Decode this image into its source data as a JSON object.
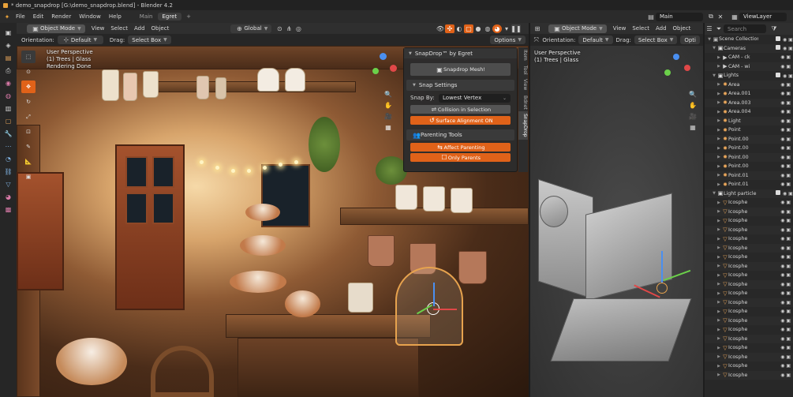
{
  "window": {
    "title": "* demo_snapdrop [G:\\demo_snapdrop.blend] - Blender 4.2"
  },
  "menu": {
    "items": [
      "File",
      "Edit",
      "Render",
      "Window",
      "Help"
    ]
  },
  "workspaces": {
    "tabs": [
      {
        "label": "Main",
        "active": false
      },
      {
        "label": "Egret",
        "active": true
      }
    ],
    "add_label": "+"
  },
  "topright": {
    "scene_label": "Main",
    "viewlayer_label": "ViewLayer"
  },
  "editor_left": {
    "mode": "Object Mode",
    "menus": [
      "View",
      "Select",
      "Add",
      "Object"
    ],
    "transform": "Global",
    "orientation_label": "Orientation:",
    "orientation_value": "Default",
    "drag_label": "Drag:",
    "drag_value": "Select Box",
    "options_label": "Options",
    "overlay": {
      "line1": "User Perspective",
      "line2": "(1) Trees | Glass",
      "line3": "Rendering Done"
    }
  },
  "npanel": {
    "title": "SnapDrop™ by Egret",
    "snapdrop_button": "Snapdrop Mesh!",
    "snap_settings": "Snap Settings",
    "snap_by_label": "Snap By:",
    "snap_by_value": "Lowest Vertex",
    "collision_button": "Collision in Selection",
    "surface_button": "Surface Alignment ON",
    "parenting_tools": "Parenting Tools",
    "affect_button": "Affect Parenting",
    "only_parents_button": "Only Parents",
    "accent": "#e06219"
  },
  "sidetabs": {
    "items": [
      "Item",
      "Tool",
      "View",
      "Bdnet",
      "SnapDrop"
    ]
  },
  "editor_right": {
    "mode": "Object Mode",
    "menus": [
      "View",
      "Select",
      "Add",
      "Object"
    ],
    "orientation_label": "Orientation:",
    "orientation_value": "Default",
    "drag_label": "Drag:",
    "drag_value": "Select Box",
    "options_label": "Opti",
    "overlay": {
      "line1": "User Perspective",
      "line2": "(1) Trees | Glass"
    }
  },
  "outliner": {
    "search_placeholder": "Search",
    "rows": [
      {
        "name": "Scene Collection",
        "depth": 0,
        "icon": "box",
        "color": "#bdbdbd",
        "collection": true
      },
      {
        "name": "Cameras",
        "depth": 1,
        "icon": "box",
        "color": "#e0e0e0",
        "collection": true
      },
      {
        "name": "CAM - ck",
        "depth": 2,
        "icon": "cam",
        "color": "#cfcfcf"
      },
      {
        "name": "CAM - wi",
        "depth": 2,
        "icon": "cam",
        "color": "#cfcfcf"
      },
      {
        "name": "Lights",
        "depth": 1,
        "icon": "box",
        "color": "#e0e0e0",
        "collection": true
      },
      {
        "name": "Area",
        "depth": 2,
        "icon": "light",
        "color": "#e8a55a"
      },
      {
        "name": "Area.001",
        "depth": 2,
        "icon": "light",
        "color": "#e8a55a"
      },
      {
        "name": "Area.003",
        "depth": 2,
        "icon": "light",
        "color": "#e8a55a"
      },
      {
        "name": "Area.004",
        "depth": 2,
        "icon": "light",
        "color": "#e8a55a"
      },
      {
        "name": "Light",
        "depth": 2,
        "icon": "light",
        "color": "#e8a55a"
      },
      {
        "name": "Point",
        "depth": 2,
        "icon": "light",
        "color": "#e8a55a"
      },
      {
        "name": "Point.00",
        "depth": 2,
        "icon": "light",
        "color": "#e8a55a"
      },
      {
        "name": "Point.00",
        "depth": 2,
        "icon": "light",
        "color": "#e8a55a"
      },
      {
        "name": "Point.00",
        "depth": 2,
        "icon": "light",
        "color": "#e8a55a"
      },
      {
        "name": "Point.00",
        "depth": 2,
        "icon": "light",
        "color": "#e8a55a"
      },
      {
        "name": "Point.01",
        "depth": 2,
        "icon": "light",
        "color": "#e8a55a"
      },
      {
        "name": "Point.01",
        "depth": 2,
        "icon": "light",
        "color": "#e8a55a"
      },
      {
        "name": "Light particle",
        "depth": 1,
        "icon": "box",
        "color": "#e0e0e0",
        "collection": true
      },
      {
        "name": "Icosphe",
        "depth": 2,
        "icon": "tri",
        "color": "#e8a55a"
      },
      {
        "name": "Icosphe",
        "depth": 2,
        "icon": "tri",
        "color": "#e8a55a"
      },
      {
        "name": "Icosphe",
        "depth": 2,
        "icon": "tri",
        "color": "#e8a55a"
      },
      {
        "name": "Icosphe",
        "depth": 2,
        "icon": "tri",
        "color": "#e8a55a"
      },
      {
        "name": "Icosphe",
        "depth": 2,
        "icon": "tri",
        "color": "#e8a55a"
      },
      {
        "name": "Icosphe",
        "depth": 2,
        "icon": "tri",
        "color": "#e8a55a"
      },
      {
        "name": "Icosphe",
        "depth": 2,
        "icon": "tri",
        "color": "#e8a55a"
      },
      {
        "name": "Icosphe",
        "depth": 2,
        "icon": "tri",
        "color": "#e8a55a"
      },
      {
        "name": "Icosphe",
        "depth": 2,
        "icon": "tri",
        "color": "#e8a55a"
      },
      {
        "name": "Icosphe",
        "depth": 2,
        "icon": "tri",
        "color": "#e8a55a"
      },
      {
        "name": "Icosphe",
        "depth": 2,
        "icon": "tri",
        "color": "#e8a55a"
      },
      {
        "name": "Icosphe",
        "depth": 2,
        "icon": "tri",
        "color": "#e8a55a"
      },
      {
        "name": "Icosphe",
        "depth": 2,
        "icon": "tri",
        "color": "#e8a55a"
      },
      {
        "name": "Icosphe",
        "depth": 2,
        "icon": "tri",
        "color": "#e8a55a"
      },
      {
        "name": "Icosphe",
        "depth": 2,
        "icon": "tri",
        "color": "#e8a55a"
      },
      {
        "name": "Icosphe",
        "depth": 2,
        "icon": "tri",
        "color": "#e8a55a"
      },
      {
        "name": "Icosphe",
        "depth": 2,
        "icon": "tri",
        "color": "#e8a55a"
      },
      {
        "name": "Icosphe",
        "depth": 2,
        "icon": "tri",
        "color": "#e8a55a"
      },
      {
        "name": "Icosphe",
        "depth": 2,
        "icon": "tri",
        "color": "#e8a55a"
      },
      {
        "name": "Icosphe",
        "depth": 2,
        "icon": "tri",
        "color": "#e8a55a"
      }
    ]
  }
}
